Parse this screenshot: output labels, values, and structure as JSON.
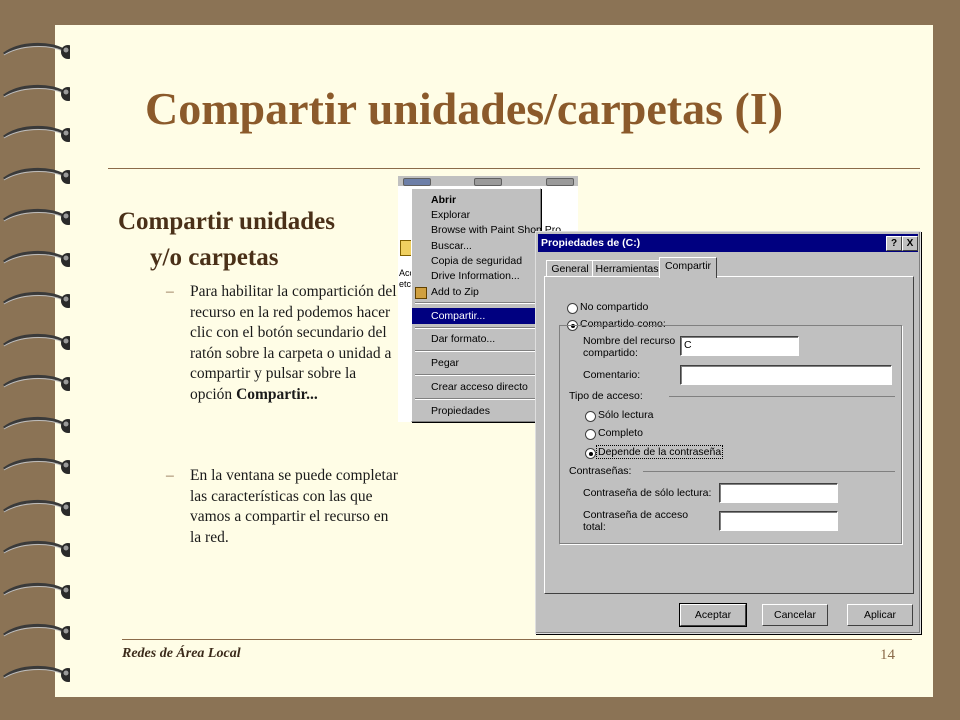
{
  "slide": {
    "title": "Compartir unidades/carpetas (I)",
    "subheading_line1": "Compartir unidades",
    "subheading_line2": "y/o carpetas",
    "bullets": [
      {
        "dash": "–",
        "text": "Para habilitar la compartición del recurso en la red podemos hacer clic con el botón secundario del ratón sobre la carpeta o unidad a compartir y pulsar sobre la opción ",
        "bold": "Compartir..."
      },
      {
        "dash": "–",
        "text": "En la ventana se puede completar las características con las que vamos a compartir el recurso en la red.",
        "bold": ""
      }
    ],
    "footer_left": "Redes de Área Local",
    "page_number": "14"
  },
  "context_menu": {
    "side_text_1": "Acc",
    "side_text_2": "etc",
    "items": [
      {
        "label": "Abrir",
        "bold": true
      },
      {
        "label": "Explorar"
      },
      {
        "label": "Browse with Paint Shop Pro"
      },
      {
        "label": "Buscar..."
      },
      {
        "label": "Copia de seguridad"
      },
      {
        "label": "Drive Information..."
      },
      {
        "label": "Add to Zip"
      },
      {
        "label": "Compartir...",
        "highlighted": true
      },
      {
        "label": "Dar formato..."
      },
      {
        "label": "Pegar"
      },
      {
        "label": "Crear acceso directo"
      },
      {
        "label": "Propiedades"
      }
    ]
  },
  "dialog": {
    "title": "Propiedades de  (C:)",
    "help_button": "?",
    "close_button": "X",
    "tabs": [
      "General",
      "Herramientas",
      "Compartir"
    ],
    "active_tab": "Compartir",
    "no_compartido": "No compartido",
    "compartido_como": "Compartido como:",
    "share_state": "Compartido como:",
    "nombre_label_1": "Nombre del recurso",
    "nombre_label_2": "compartido:",
    "nombre_value": "C",
    "comentario_label": "Comentario:",
    "comentario_value": "",
    "tipo_acceso": "Tipo de acceso:",
    "solo_lectura": "Sólo lectura",
    "completo": "Completo",
    "depende": "Depende de la contraseña",
    "access_selected": "Depende de la contraseña",
    "contrasenas": "Contraseñas:",
    "pw_read_label": "Contraseña de sólo lectura:",
    "pw_full_label_1": "Contraseña de acceso",
    "pw_full_label_2": "total:",
    "pw_read_value": "",
    "pw_full_value": "",
    "buttons": {
      "aceptar": "Aceptar",
      "cancelar": "Cancelar",
      "aplicar": "Aplicar"
    }
  },
  "colors": {
    "title": "#8b5a2b",
    "background": "#fffde6",
    "frame": "#8b7355",
    "dialog_title": "#000080"
  }
}
